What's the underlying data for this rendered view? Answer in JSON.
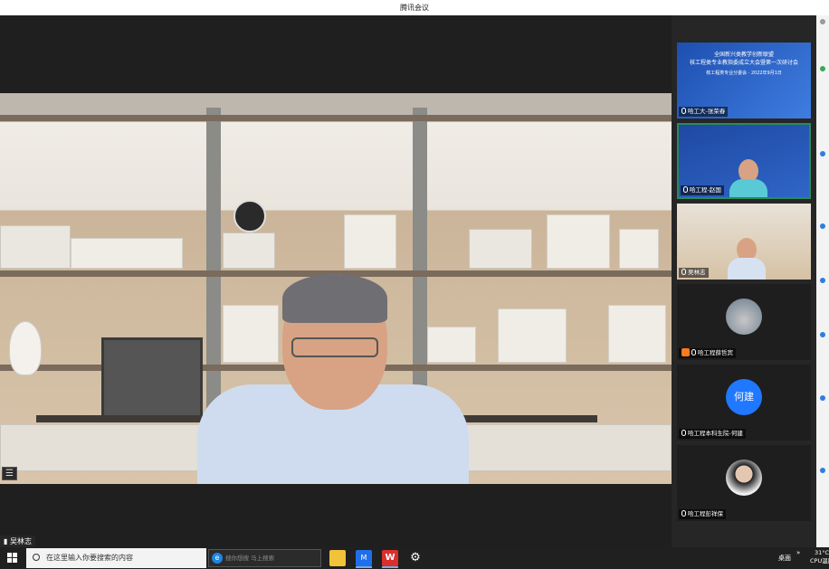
{
  "window": {
    "title": "腾讯会议"
  },
  "main_video": {
    "speaker_name": "吴林志"
  },
  "participants": [
    {
      "name": "哈工大-张荣春",
      "banner_lines": [
        "全国新兴类教学创新联盟",
        "核工程类专业教指委成立大会暨第一次研讨会",
        "核工程类专业分委会 · 2022年9月1日"
      ]
    },
    {
      "name": "哈工程-赵国"
    },
    {
      "name": "吴林志"
    },
    {
      "name": "哈工程薛哲宾"
    },
    {
      "name": "哈工程本科生院-何建",
      "avatar_text": "何建"
    },
    {
      "name": "哈工程彭祥保"
    }
  ],
  "taskbar": {
    "search_placeholder": "在这里输入你要搜索的内容",
    "browser_hint": "搜你想搜 马上搜索",
    "meeting_icon_label": "M",
    "wps_label": "W",
    "gear_glyph": "⚙",
    "desktop_label": "桌面",
    "overflow_arrows": "»",
    "temperature": "31°C",
    "cpu_label": "CPU温度"
  },
  "colors": {
    "active_border": "#2b8a5a",
    "avatar_blue": "#1f78ff",
    "taskbar": "#202020"
  }
}
